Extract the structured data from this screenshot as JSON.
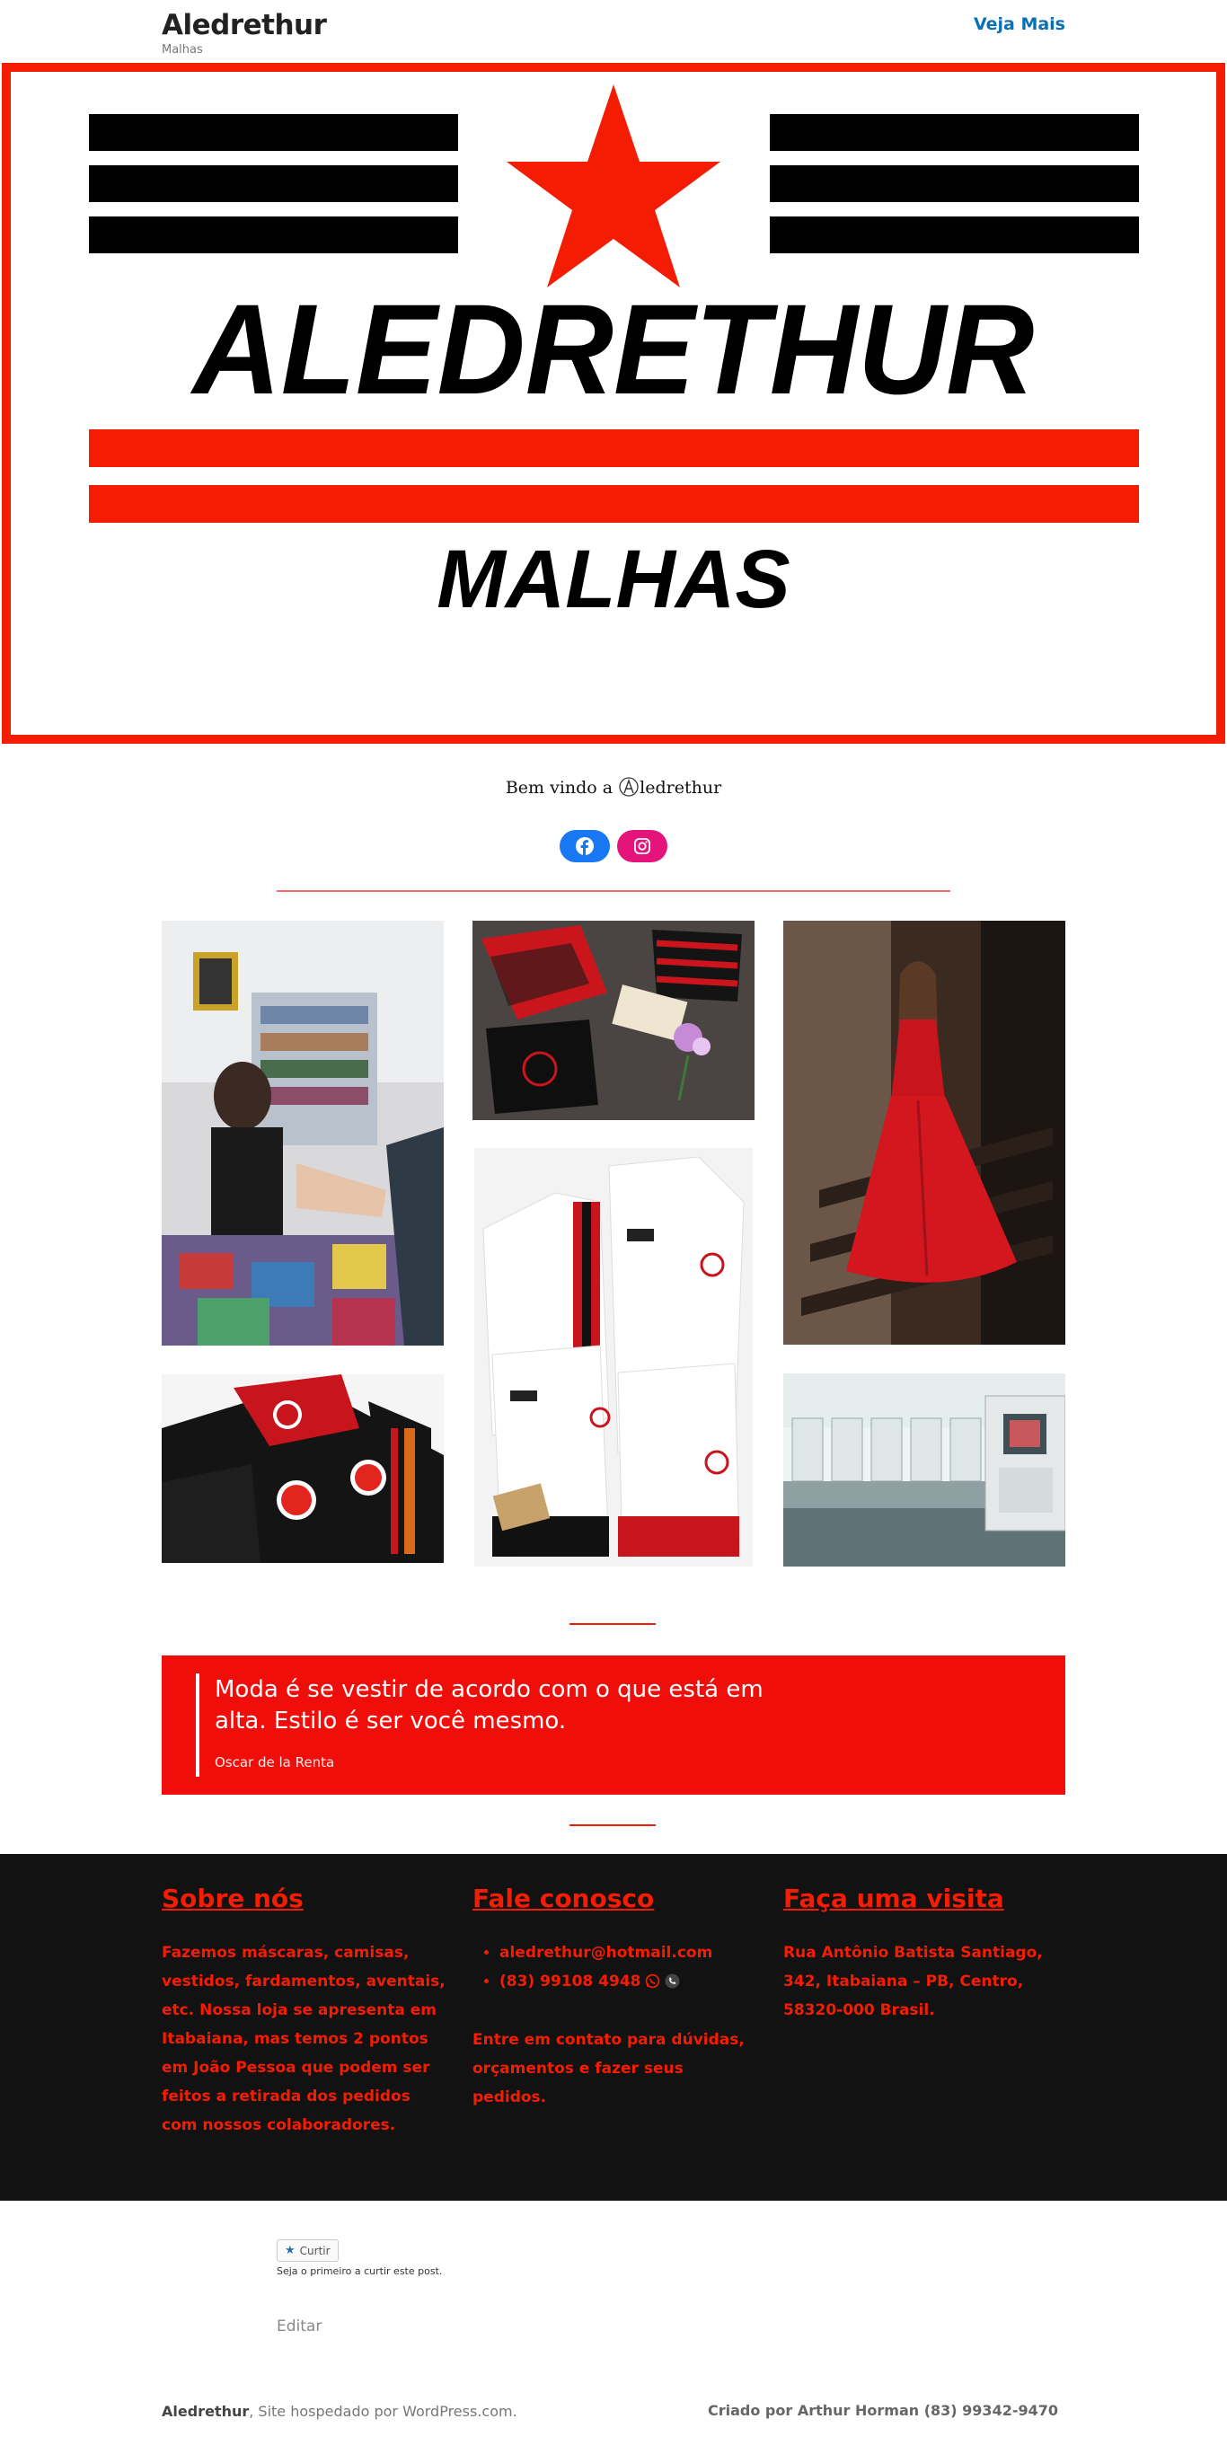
{
  "header": {
    "site_title": "Aledrethur",
    "site_description": "Malhas",
    "nav_link": "Veja Mais"
  },
  "banner": {
    "brand": "ALEDRETHUR",
    "sub": "MALHAS",
    "colors": {
      "red": "#f41c03",
      "black": "#000000"
    }
  },
  "welcome": {
    "prefix": "Bem vindo a ",
    "suffix": "ledrethur"
  },
  "socials": {
    "facebook": "facebook-icon",
    "instagram": "instagram-icon"
  },
  "quote": {
    "text": "Moda é se vestir de acordo com o que está em alta. Estilo é ser você mesmo.",
    "cite": "Oscar de la Renta"
  },
  "footer_widgets": {
    "about": {
      "title": "Sobre nós",
      "text": "Fazemos máscaras, camisas, vestidos, fardamentos, aventais, etc. Nossa loja se apresenta em Itabaiana, mas temos 2 pontos em João Pessoa que podem ser feitos a retirada dos pedidos com nossos colaboradores."
    },
    "contact": {
      "title": "Fale conosco",
      "items": [
        "aledrethur@hotmail.com",
        "(83) 99108 4948"
      ],
      "text": "Entre em contato para dúvidas, orçamentos e fazer seus pedidos."
    },
    "visit": {
      "title": "Faça uma visita",
      "text": "Rua Antônio Batista Santiago, 342, Itabaiana – PB, Centro, 58320-000 Brasil."
    }
  },
  "like": {
    "button": "Curtir",
    "note": "Seja o primeiro a curtir este post."
  },
  "edit_link": "Editar",
  "credits": {
    "site": "Aledrethur",
    "hosted": ", Site hospedado por WordPress.com.",
    "right": "Criado por Arthur Horman (83) 99342-9470"
  }
}
